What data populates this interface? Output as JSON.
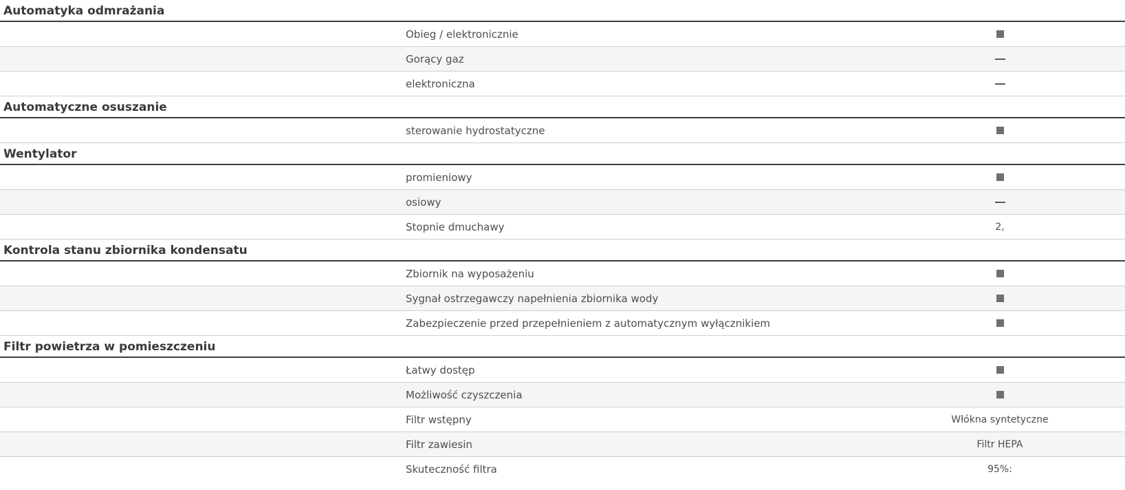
{
  "sections": [
    {
      "title": "Automatyka odmrażania",
      "rows": [
        {
          "label": "Obieg / elektronicznie",
          "value": "",
          "icon": "square-icon"
        },
        {
          "label": "Gorący gaz",
          "value": "",
          "icon": "dash-icon"
        },
        {
          "label": "elektroniczna",
          "value": "",
          "icon": "dash-icon"
        }
      ]
    },
    {
      "title": "Automatyczne osuszanie",
      "rows": [
        {
          "label": "sterowanie hydrostatyczne",
          "value": "",
          "icon": "square-icon"
        }
      ]
    },
    {
      "title": "Wentylator",
      "rows": [
        {
          "label": "promieniowy",
          "value": "",
          "icon": "square-icon"
        },
        {
          "label": "osiowy",
          "value": "",
          "icon": "dash-icon"
        },
        {
          "label": "Stopnie dmuchawy",
          "value": "2,",
          "icon": ""
        }
      ]
    },
    {
      "title": "Kontrola stanu zbiornika kondensatu",
      "rows": [
        {
          "label": "Zbiornik na wyposażeniu",
          "value": "",
          "icon": "square-icon"
        },
        {
          "label": "Sygnał ostrzegawczy napełnienia zbiornika wody",
          "value": "",
          "icon": "square-icon"
        },
        {
          "label": "Zabezpieczenie przed przepełnieniem z automatycznym wyłącznikiem",
          "value": "",
          "icon": "square-icon"
        }
      ]
    },
    {
      "title": "Filtr powietrza w pomieszczeniu",
      "rows": [
        {
          "label": "Łatwy dostęp",
          "value": "",
          "icon": "square-icon"
        },
        {
          "label": "Możliwość czyszczenia",
          "value": "",
          "icon": "square-icon"
        },
        {
          "label": "Filtr wstępny",
          "value": "Włókna syntetyczne",
          "icon": ""
        },
        {
          "label": "Filtr zawiesin",
          "value": "Filtr HEPA",
          "icon": ""
        },
        {
          "label": "Skuteczność filtra",
          "value": "95%:",
          "icon": ""
        }
      ]
    }
  ]
}
